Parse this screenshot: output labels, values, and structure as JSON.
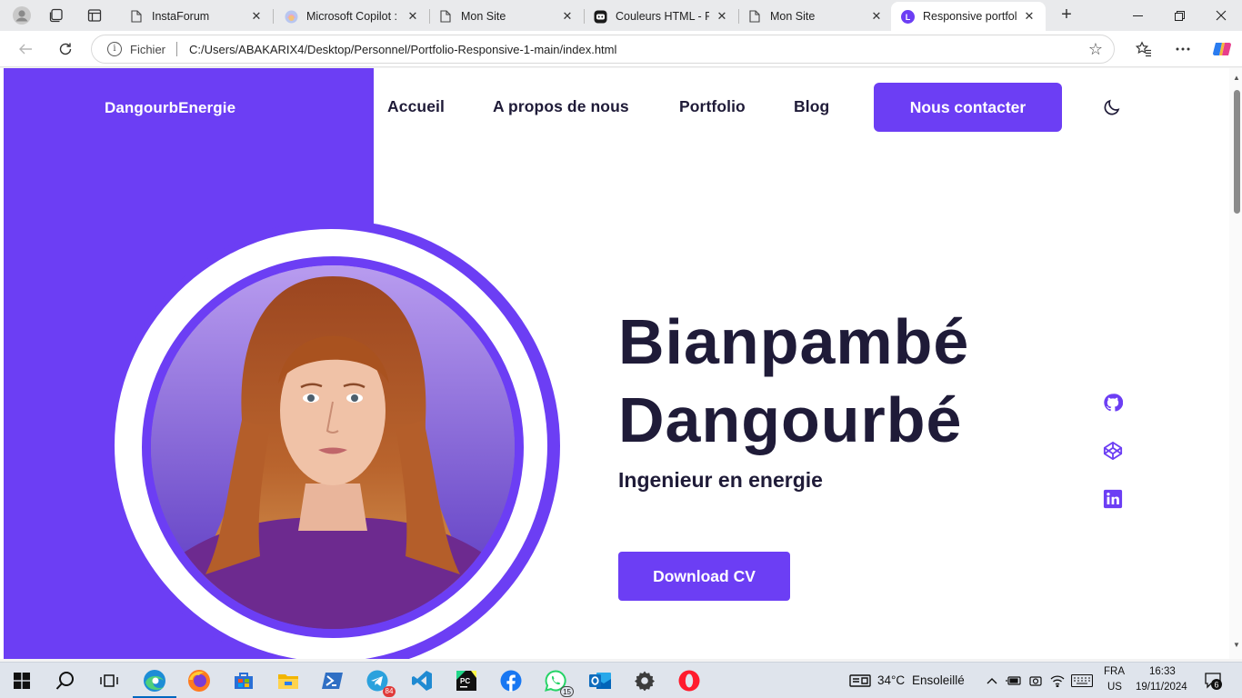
{
  "browser": {
    "tabs": [
      {
        "label": "InstaForum",
        "favicon": "page-icon"
      },
      {
        "label": "Microsoft Copilot : vo",
        "favicon": "copilot-icon"
      },
      {
        "label": "Mon Site",
        "favicon": "page-icon"
      },
      {
        "label": "Couleurs HTML - Pou",
        "favicon": "bot-icon"
      },
      {
        "label": "Mon Site",
        "favicon": "page-icon"
      },
      {
        "label": "Responsive portfolio",
        "favicon": "l-badge-icon",
        "active": true
      }
    ],
    "address": {
      "scheme_label": "Fichier",
      "url": "C:/Users/ABAKARIX4/Desktop/Personnel/Portfolio-Responsive-1-main/index.html"
    }
  },
  "site": {
    "brand": "DangourbEnergie",
    "nav": [
      "Accueil",
      "A propos de nous",
      "Portfolio",
      "Blog"
    ],
    "contact_button": "Nous contacter",
    "hero": {
      "first_name": "Bianpambé",
      "last_name": "Dangourbé",
      "role": "Ingenieur en energie",
      "cv_button": "Download CV"
    },
    "social": [
      "github-icon",
      "codepen-icon",
      "linkedin-icon"
    ],
    "accent_color": "#6c3ef4",
    "text_color": "#1f1b38"
  },
  "taskbar": {
    "apps": [
      "start",
      "search",
      "task-view",
      "edge",
      "firefox",
      "store",
      "file-explorer",
      "powershell",
      "telegram",
      "vscode",
      "pycharm",
      "facebook",
      "whatsapp",
      "outlook",
      "settings",
      "opera"
    ],
    "telegram_badge": "84",
    "whatsapp_badge": "15",
    "weather": {
      "temp": "34°C",
      "condition": "Ensoleillé"
    },
    "lang": {
      "line1": "FRA",
      "line2": "US"
    },
    "clock": {
      "time": "16:33",
      "date": "19/11/2024"
    },
    "notifications": "6"
  }
}
